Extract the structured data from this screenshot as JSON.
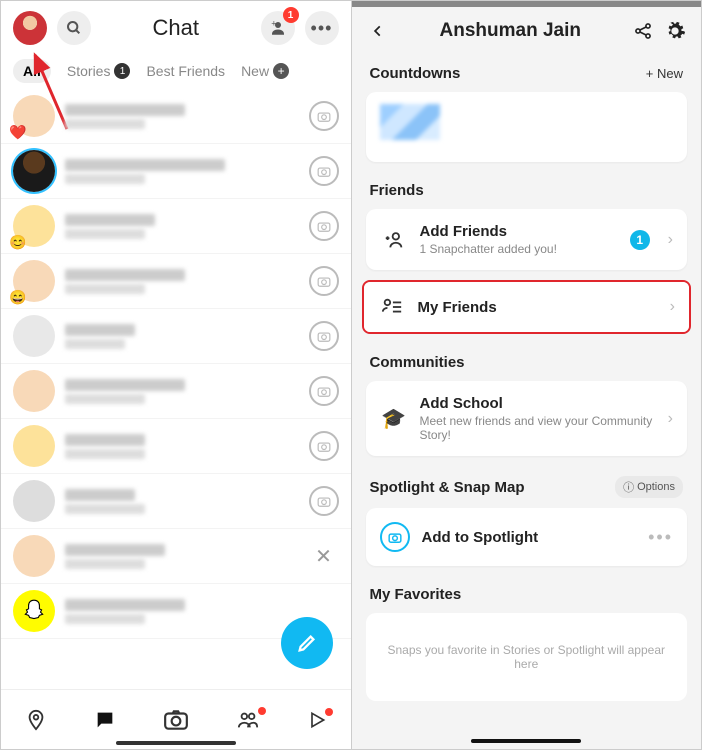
{
  "left": {
    "title": "Chat",
    "addFriendBadge": "1",
    "filters": {
      "all": "All",
      "stories": "Stories",
      "storiesBadge": "1",
      "bestFriends": "Best Friends",
      "new": "New"
    }
  },
  "right": {
    "title": "Anshuman Jain",
    "countdowns": {
      "title": "Countdowns",
      "newBtn": "+ New"
    },
    "friends": {
      "title": "Friends",
      "add": {
        "title": "Add Friends",
        "sub": "1 Snapchatter added you!",
        "badge": "1"
      },
      "my": {
        "title": "My Friends"
      }
    },
    "communities": {
      "title": "Communities",
      "row": {
        "title": "Add School",
        "sub": "Meet new friends and view your Community Story!"
      }
    },
    "spotlight": {
      "title": "Spotlight & Snap Map",
      "options": "Options",
      "row": "Add to Spotlight"
    },
    "favorites": {
      "title": "My Favorites",
      "empty": "Snaps you favorite in Stories or Spotlight will appear here"
    }
  }
}
